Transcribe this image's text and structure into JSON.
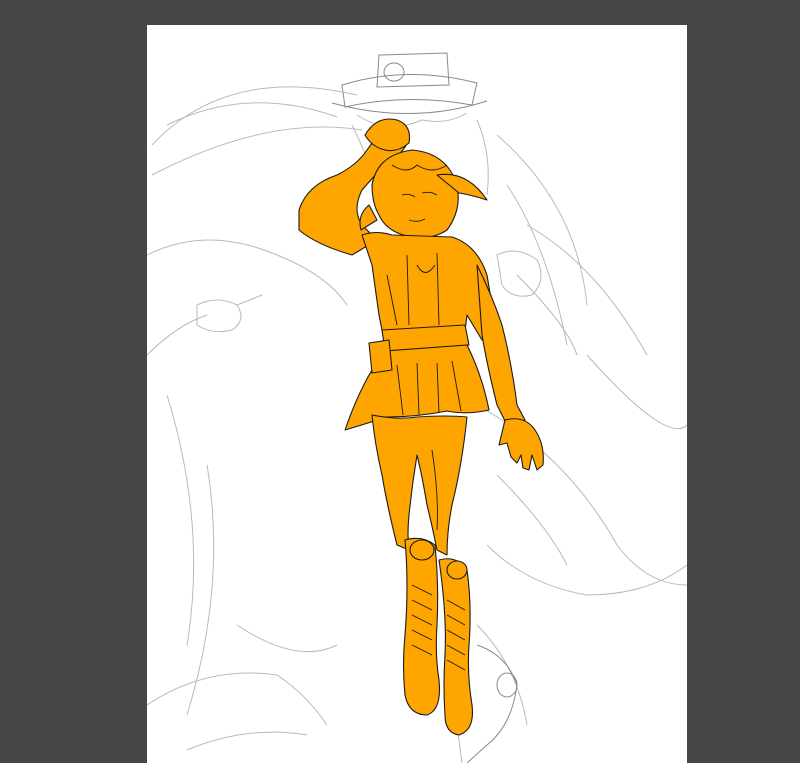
{
  "colors": {
    "workspace_bg": "#464646",
    "canvas_bg": "#ffffff",
    "figure_fill": "#ffa500",
    "lineart": "#1a1a1a",
    "sketch_lines": "#b9b9b9",
    "sketch_dark": "#8a8a8a"
  },
  "icons": {
    "canvas": "drawing-canvas-icon"
  }
}
